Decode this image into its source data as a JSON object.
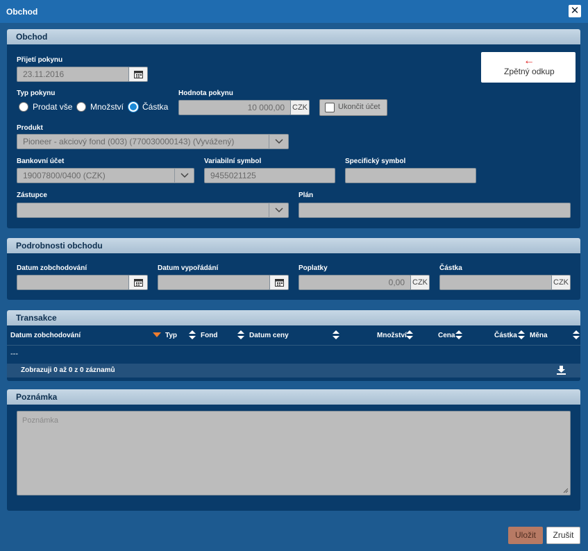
{
  "window": {
    "title": "Obchod",
    "close_icon": "close-icon"
  },
  "obchod": {
    "header": "Obchod",
    "prijeti_label": "Přijetí pokynu",
    "prijeti_value": "23.11.2016",
    "zpetny_odkup": {
      "arrow": "←",
      "label": "Zpětný odkup"
    },
    "typ_label": "Typ pokynu",
    "typ_options": [
      "Prodat vše",
      "Množství",
      "Částka"
    ],
    "typ_selected": "Částka",
    "hodnota_label": "Hodnota pokynu",
    "hodnota_value": "10 000,00",
    "hodnota_currency": "CZK",
    "ukoncit_label": "Ukončit účet",
    "produkt_label": "Produkt",
    "produkt_value": "Pioneer - akciový fond (003) (770030000143) (Vyvážený)",
    "bankovni_label": "Bankovní účet",
    "bankovni_value": "19007800/0400 (CZK)",
    "variabilni_label": "Variabilní symbol",
    "variabilni_value": "9455021125",
    "specificky_label": "Specifický symbol",
    "specificky_value": "",
    "zastupce_label": "Zástupce",
    "zastupce_value": "",
    "plan_label": "Plán",
    "plan_value": ""
  },
  "podrobnosti": {
    "header": "Podrobnosti obchodu",
    "datum_zob_label": "Datum zobchodování",
    "datum_zob_value": "",
    "datum_vyp_label": "Datum vypořádání",
    "datum_vyp_value": "",
    "poplatky_label": "Poplatky",
    "poplatky_value": "0,00",
    "poplatky_currency": "CZK",
    "castka_label": "Částka",
    "castka_value": "",
    "castka_currency": "CZK"
  },
  "transakce": {
    "header": "Transakce",
    "columns": [
      "Datum zobchodování",
      "Typ",
      "Fond",
      "Datum ceny",
      "Množství",
      "Cena",
      "Částka",
      "Měna"
    ],
    "empty_row": "---",
    "pager_text": "Zobrazuji 0 až 0 z 0 záznamů",
    "sort_active_color": "#f07d2e"
  },
  "poznamka": {
    "header": "Poznámka",
    "placeholder": "Poznámka"
  },
  "footer": {
    "save_label": "Uložit",
    "cancel_label": "Zrušit"
  }
}
